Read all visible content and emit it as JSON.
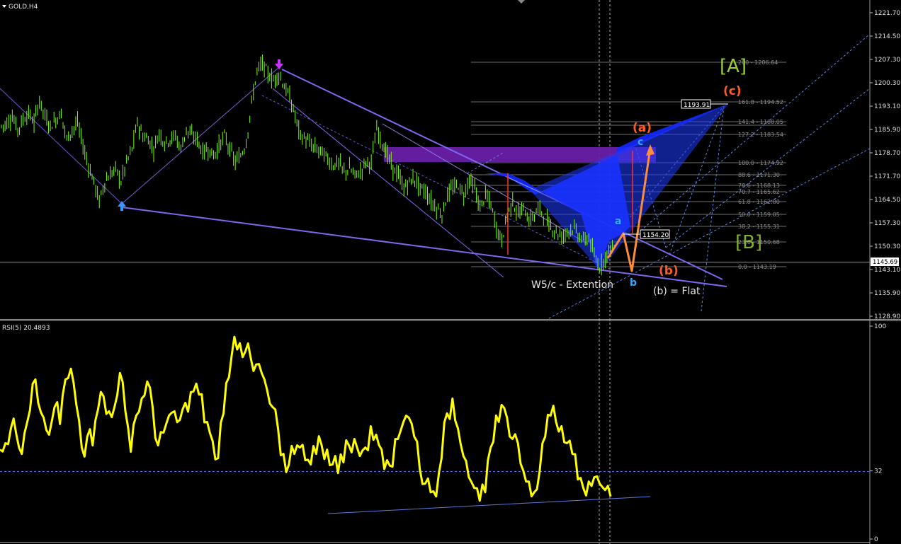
{
  "window": {
    "title": "GOLD,H4",
    "indicator_title": "RSI(5) 20.4893"
  },
  "price_axis": {
    "labels": [
      "1221.70",
      "1214.50",
      "1207.30",
      "1200.30",
      "1193.10",
      "1185.90",
      "1178.70",
      "1171.70",
      "1164.50",
      "1157.30",
      "1150.30",
      "1143.10",
      "1135.90",
      "1128.90"
    ],
    "current_price": "1145.69"
  },
  "rsi_axis": {
    "labels": [
      "100",
      "32",
      "0"
    ]
  },
  "fib_levels": [
    "200 - 1206.64",
    "161.8 - 1194.52",
    "141.4 - 1188.05",
    "127.2 - 1183.54",
    "100.0 - 1174.92",
    "88.6 - 1171.30",
    "78.6 - 1168.13",
    "70.7 - 1165.62",
    "61.8 - 1162.80",
    "50.0 - 1159.05",
    "38.2 - 1155.31",
    "23.6 - 1150.68",
    "0.0 - 1143.19"
  ],
  "price_boxes": {
    "target": "1193.91",
    "point_a": "1154.20"
  },
  "wave_labels": {
    "A": "[A]",
    "B": "[B]",
    "c_big": "(c)",
    "a_paren": "(a)",
    "b_paren": "(b)",
    "a_small": "a",
    "b_small": "b",
    "c_small": "c"
  },
  "annotations": {
    "extension": "W5/c - Extention",
    "flat": "(b) = Flat"
  },
  "colors": {
    "background": "#000000",
    "candles": "#7CFC00",
    "rsi_line": "#FFFF00",
    "channel": "#7b68ee",
    "pattern_fill": "#1428ff",
    "zone": "#6a1fa8",
    "projection": "#ff8c3a",
    "wave_orange": "#ff5a1f",
    "wave_cyan": "#33aaff",
    "wave_A": "#9acd32",
    "up_arrow": "#3399ff",
    "down_arrow": "#cc33ff"
  },
  "chart_data": {
    "type": "line",
    "title": "GOLD,H4",
    "ylim": [
      1126.0,
      1224.0
    ],
    "rsi_ylim": [
      0,
      100
    ],
    "price_path": [
      1187,
      1188,
      1190,
      1186,
      1189,
      1191,
      1188,
      1195,
      1190,
      1187,
      1189,
      1191,
      1183,
      1186,
      1188,
      1181,
      1175,
      1170,
      1164,
      1170,
      1172,
      1174,
      1170,
      1176,
      1180,
      1188,
      1184,
      1183,
      1180,
      1185,
      1182,
      1183,
      1184,
      1180,
      1186,
      1184,
      1183,
      1179,
      1180,
      1178,
      1181,
      1184,
      1180,
      1176,
      1178,
      1182,
      1194,
      1204,
      1206,
      1203,
      1201,
      1203,
      1199,
      1196,
      1190,
      1184,
      1183,
      1181,
      1180,
      1179,
      1177,
      1175,
      1176,
      1173,
      1174,
      1172,
      1173,
      1176,
      1176,
      1186,
      1182,
      1178,
      1174,
      1172,
      1168,
      1170,
      1171,
      1168,
      1167,
      1164,
      1162,
      1160,
      1166,
      1168,
      1169,
      1166,
      1171,
      1168,
      1162,
      1166,
      1163,
      1156,
      1152,
      1160,
      1164,
      1160,
      1162,
      1158,
      1160,
      1162,
      1159,
      1156,
      1155,
      1153,
      1155,
      1156,
      1154,
      1152,
      1153,
      1147,
      1144,
      1147,
      1150
    ],
    "rsi_path": [
      42,
      45,
      52,
      49,
      40,
      55,
      73,
      64,
      57,
      49,
      62,
      54,
      75,
      80,
      63,
      43,
      48,
      44,
      61,
      67,
      60,
      62,
      78,
      60,
      41,
      58,
      66,
      74,
      62,
      44,
      50,
      58,
      60,
      56,
      64,
      69,
      73,
      68,
      55,
      46,
      38,
      59,
      76,
      95,
      92,
      88,
      85,
      82,
      78,
      70,
      62,
      52,
      40,
      35,
      40,
      43,
      37,
      35,
      40,
      44,
      42,
      35,
      31,
      36,
      44,
      47,
      39,
      43,
      53,
      49,
      42,
      37,
      34,
      47,
      55,
      57,
      48,
      33,
      26,
      22,
      20,
      38,
      59,
      66,
      52,
      39,
      29,
      24,
      18,
      22,
      43,
      58,
      63,
      57,
      47,
      45,
      32,
      27,
      22,
      32,
      48,
      58,
      55,
      53,
      45,
      40,
      28,
      24,
      27,
      29,
      26,
      23,
      20
    ]
  }
}
